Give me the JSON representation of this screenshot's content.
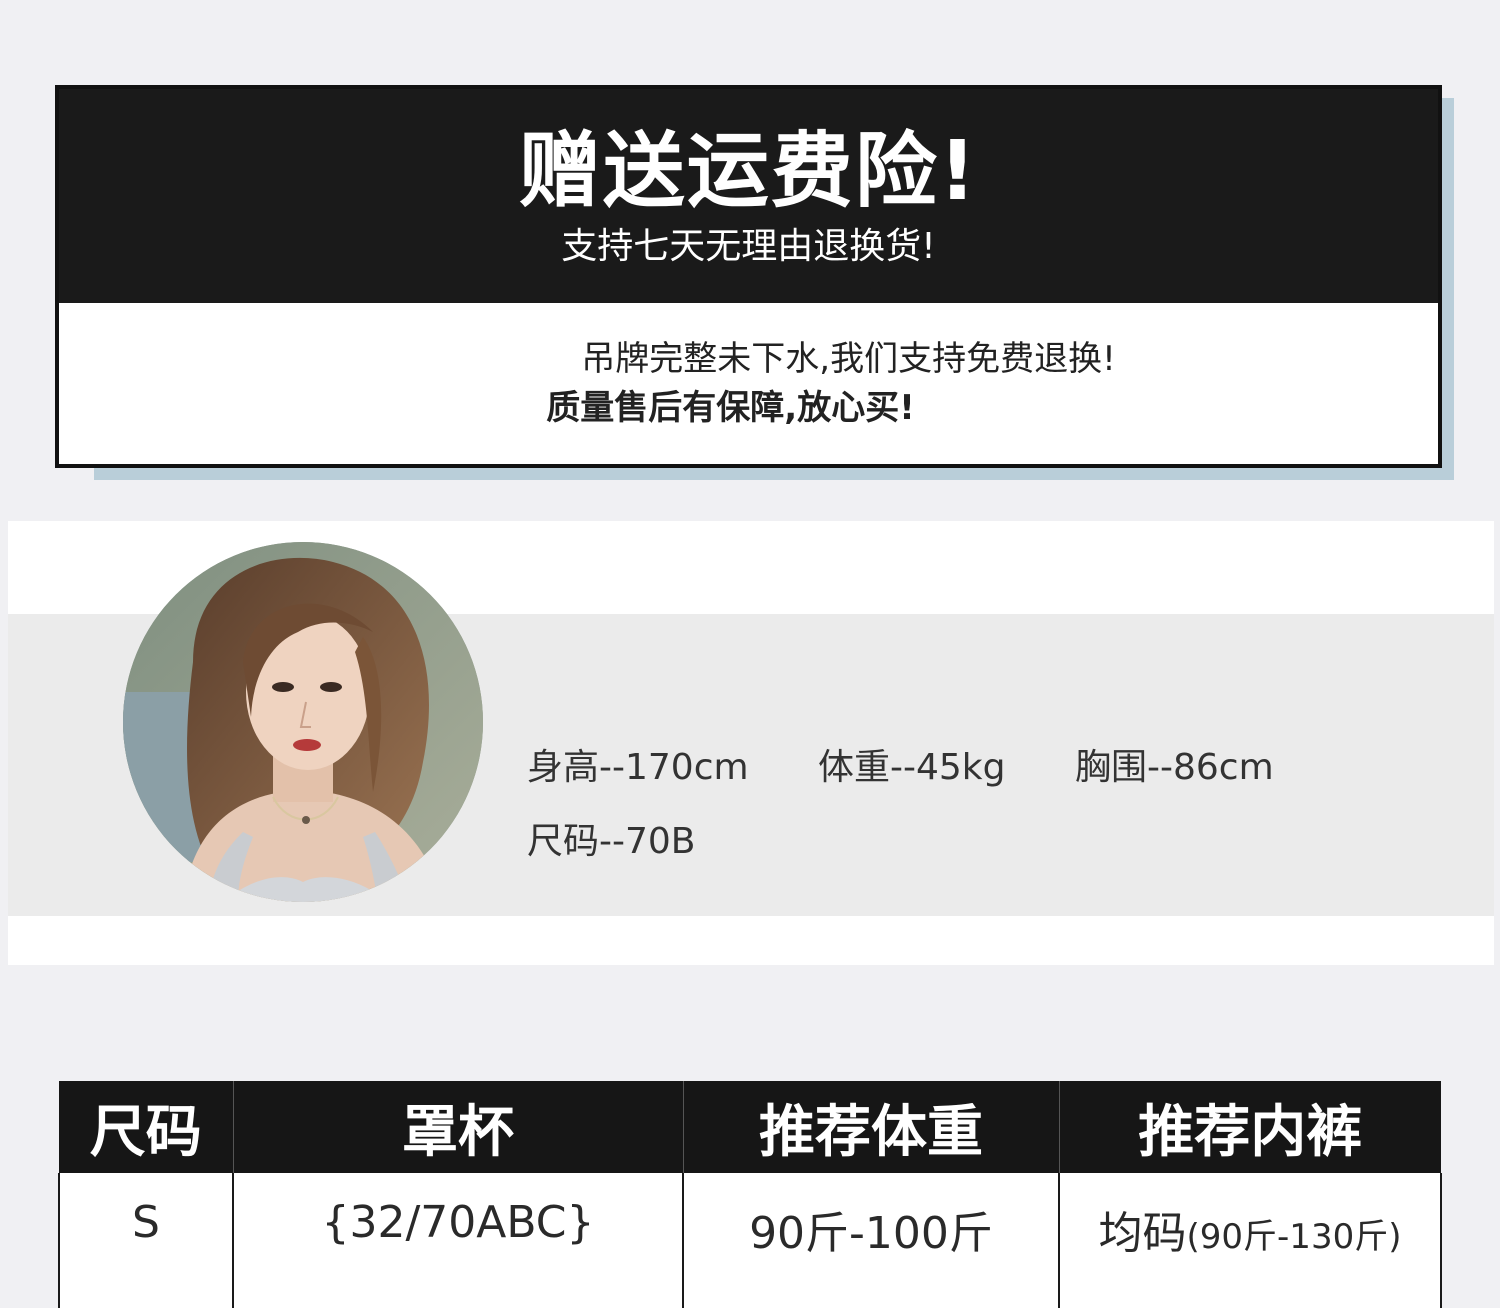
{
  "banner": {
    "title": "赠送运费险!",
    "subtitle": "支持七天无理由退换货!",
    "line1": "吊牌完整未下水,我们支持免费退换!",
    "line2": "质量售后有保障,放心买!"
  },
  "model": {
    "avatar_icon": "model-portrait",
    "height": "身高--170cm",
    "weight": "体重--45kg",
    "bust": "胸围--86cm",
    "size": "尺码--70B"
  },
  "size_table": {
    "headers": [
      "尺码",
      "罩杯",
      "推荐体重",
      "推荐内裤"
    ],
    "rows": [
      {
        "size": "S",
        "cup": "{32/70ABC}",
        "weight": "90斤-100斤",
        "panty_main": "均码",
        "panty_note": "(90斤-130斤)"
      }
    ]
  }
}
